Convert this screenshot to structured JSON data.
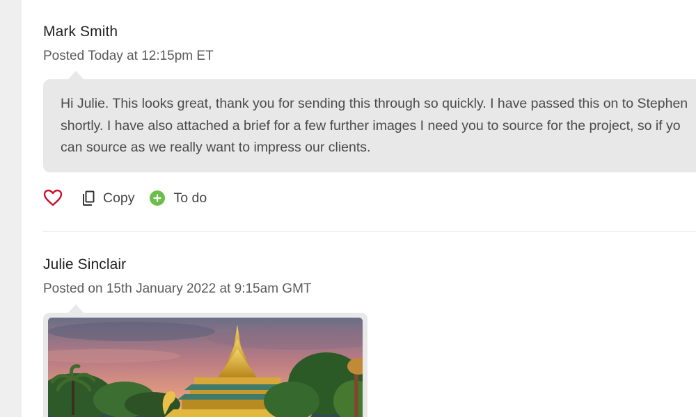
{
  "posts": [
    {
      "author": "Mark Smith",
      "posted": "Posted Today at 12:15pm ET",
      "message_lines": [
        "Hi Julie. This looks great, thank you for sending this through so quickly. I have passed this on to Stephen",
        "shortly. I have also attached a brief for a few further images I need you to source for the project, so if yo",
        "can source as we really want to impress our clients."
      ],
      "actions": {
        "like_icon": "heart-outline-icon",
        "copy_label": "Copy",
        "copy_icon": "copy-icon",
        "todo_label": "To do",
        "todo_icon": "plus-circle-icon"
      }
    },
    {
      "author": "Julie Sinclair",
      "posted": "Posted on 15th January 2022 at 9:15am GMT",
      "attachment": "photo of golden pagoda barge on water with trees at sunset"
    }
  ],
  "colors": {
    "heart": "#c8102e",
    "todo_green": "#6abf4b",
    "bubble_bg": "#e8e8e8",
    "gutter_bg": "#efefef"
  }
}
